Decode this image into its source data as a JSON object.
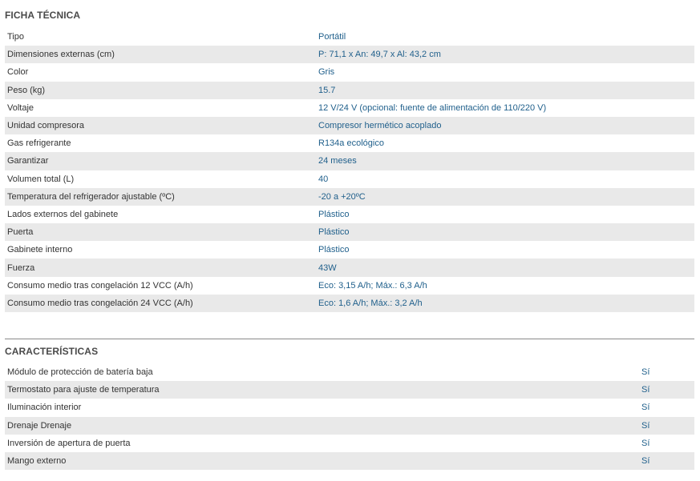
{
  "ficha": {
    "title": "FICHA TÉCNICA",
    "rows": [
      {
        "label": "Tipo",
        "value": "Portátil"
      },
      {
        "label": "Dimensiones externas (cm)",
        "value": "P: 71,1 x An: 49,7 x Al: 43,2 cm"
      },
      {
        "label": "Color",
        "value": "Gris"
      },
      {
        "label": "Peso (kg)",
        "value": "15.7"
      },
      {
        "label": "Voltaje",
        "value": "12 V/24 V (opcional: fuente de alimentación de 110/220 V)"
      },
      {
        "label": "Unidad compresora",
        "value": "Compresor hermético acoplado"
      },
      {
        "label": "Gas refrigerante",
        "value": "R134a ecológico"
      },
      {
        "label": "Garantizar",
        "value": "24 meses"
      },
      {
        "label": "Volumen total (L)",
        "value": "40"
      },
      {
        "label": "Temperatura del refrigerador ajustable (ºC)",
        "value": "-20 a +20ºC"
      },
      {
        "label": "Lados externos del gabinete",
        "value": "Plástico"
      },
      {
        "label": "Puerta",
        "value": "Plástico"
      },
      {
        "label": "Gabinete interno",
        "value": "Plástico"
      },
      {
        "label": "Fuerza",
        "value": "43W"
      },
      {
        "label": "Consumo medio tras congelación 12 VCC (A/h)",
        "value": "Eco: 3,15 A/h; Máx.: 6,3 A/h"
      },
      {
        "label": "Consumo medio tras congelación 24 VCC (A/h)",
        "value": "Eco: 1,6 A/h; Máx.: 3,2 A/h"
      }
    ]
  },
  "caracteristicas": {
    "title": "CARACTERÍSTICAS",
    "rows": [
      {
        "label": "Módulo de protección de batería baja",
        "value": "Sí"
      },
      {
        "label": "Termostato para ajuste de temperatura",
        "value": "Sí"
      },
      {
        "label": "Iluminación interior",
        "value": "Sí"
      },
      {
        "label": "Drenaje Drenaje",
        "value": "Sí"
      },
      {
        "label": "Inversión de apertura de puerta",
        "value": "Sí"
      },
      {
        "label": "Mango externo",
        "value": "Sí"
      }
    ]
  },
  "colors": {
    "value_text": "#1f5f8b",
    "label_text": "#333333",
    "stripe": "#e9e9e9"
  }
}
